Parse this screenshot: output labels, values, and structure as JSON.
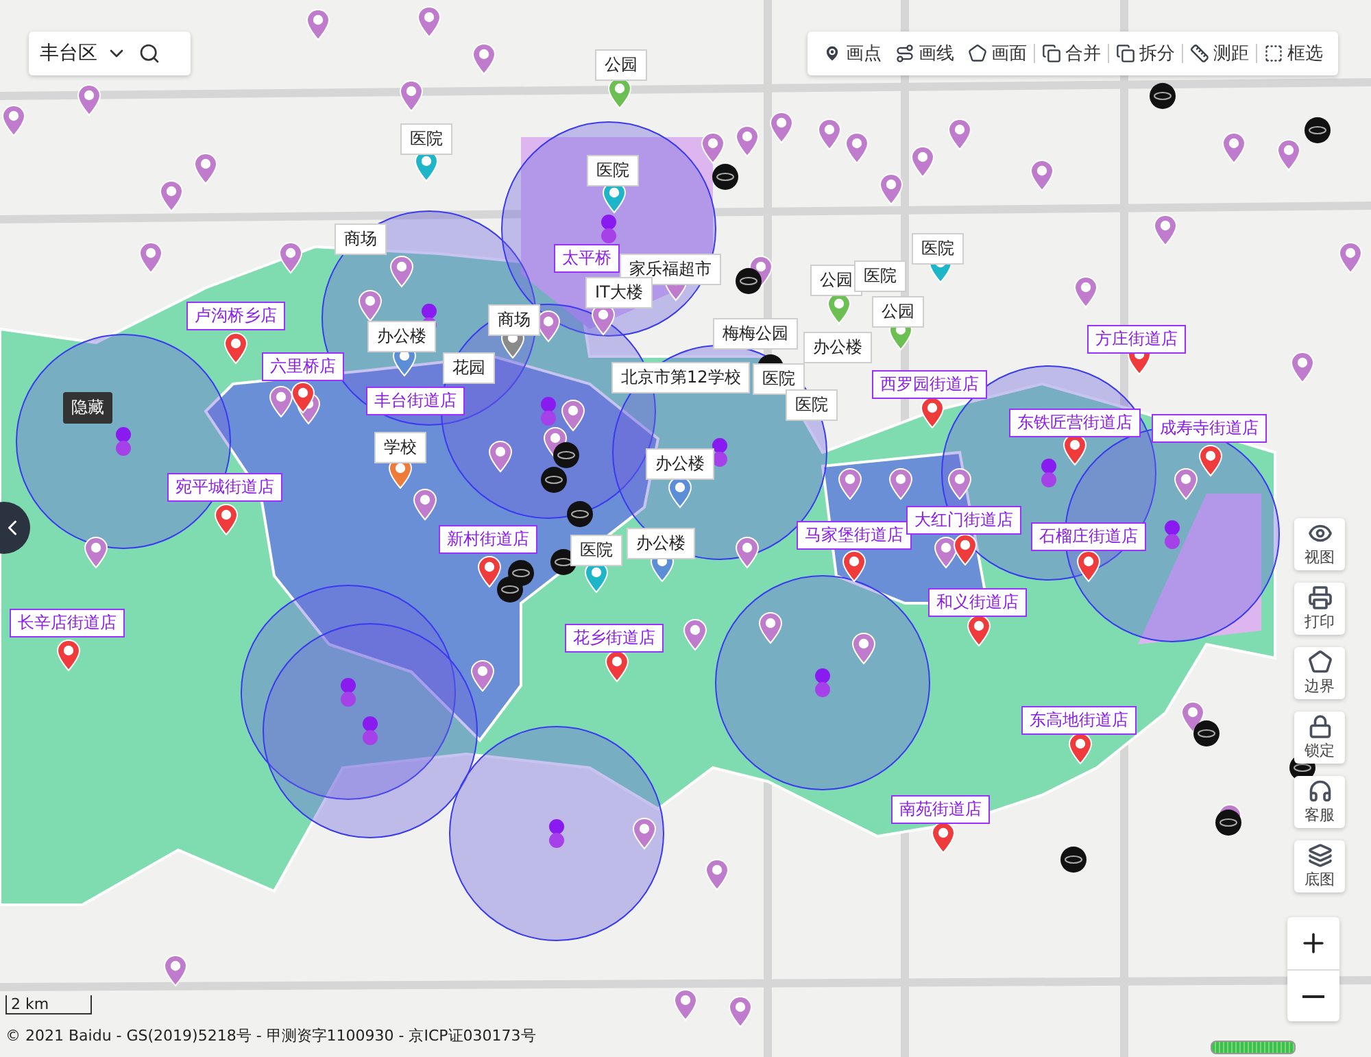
{
  "district_select": {
    "value": "丰台区"
  },
  "toolbar": [
    {
      "kind": "point",
      "label": "画点"
    },
    {
      "kind": "line",
      "label": "画线"
    },
    {
      "kind": "polygon",
      "label": "画面"
    },
    {
      "kind": "merge",
      "label": "合并"
    },
    {
      "kind": "split",
      "label": "拆分"
    },
    {
      "kind": "measure",
      "label": "测距"
    },
    {
      "kind": "select",
      "label": "框选"
    }
  ],
  "store_labels": [
    {
      "label": "卢沟桥乡店"
    },
    {
      "label": "六里桥店"
    },
    {
      "label": "丰台街道店"
    },
    {
      "label": "宛平城街道店"
    },
    {
      "label": "新村街道店"
    },
    {
      "label": "太平桥"
    },
    {
      "label": "长辛店街道店"
    },
    {
      "label": "花乡街道店"
    },
    {
      "label": "西罗园街道店"
    },
    {
      "label": "方庄街道店"
    },
    {
      "label": "东铁匠营街道店"
    },
    {
      "label": "成寿寺街道店"
    },
    {
      "label": "马家堡街道店"
    },
    {
      "label": "大红门街道店"
    },
    {
      "label": "石榴庄街道店"
    },
    {
      "label": "和义街道店"
    },
    {
      "label": "东高地街道店"
    },
    {
      "label": "南苑街道店"
    }
  ],
  "poi_labels": [
    {
      "label": "公园"
    },
    {
      "label": "医院"
    },
    {
      "label": "医院"
    },
    {
      "label": "商场"
    },
    {
      "label": "家乐福超市"
    },
    {
      "label": "IT大楼"
    },
    {
      "label": "公园"
    },
    {
      "label": "医院"
    },
    {
      "label": "医院"
    },
    {
      "label": "公园"
    },
    {
      "label": "办公楼"
    },
    {
      "label": "商场"
    },
    {
      "label": "梅梅公园"
    },
    {
      "label": "办公楼"
    },
    {
      "label": "花园"
    },
    {
      "label": "北京市第12学校"
    },
    {
      "label": "医院"
    },
    {
      "label": "医院"
    },
    {
      "label": "学校"
    },
    {
      "label": "办公楼"
    },
    {
      "label": "医院"
    },
    {
      "label": "办公楼"
    }
  ],
  "tooltip": {
    "label": "隐藏"
  },
  "side_tools": [
    {
      "kind": "view",
      "label": "视图"
    },
    {
      "kind": "print",
      "label": "打印"
    },
    {
      "kind": "boundary",
      "label": "边界"
    },
    {
      "kind": "lock",
      "label": "锁定"
    },
    {
      "kind": "service",
      "label": "客服"
    },
    {
      "kind": "basemap",
      "label": "底图"
    }
  ],
  "scale_bar": {
    "label": "2 km"
  },
  "copyright": "© 2021 Baidu - GS(2019)5218号 - 甲测资字1100930 - 京ICP证030173号"
}
